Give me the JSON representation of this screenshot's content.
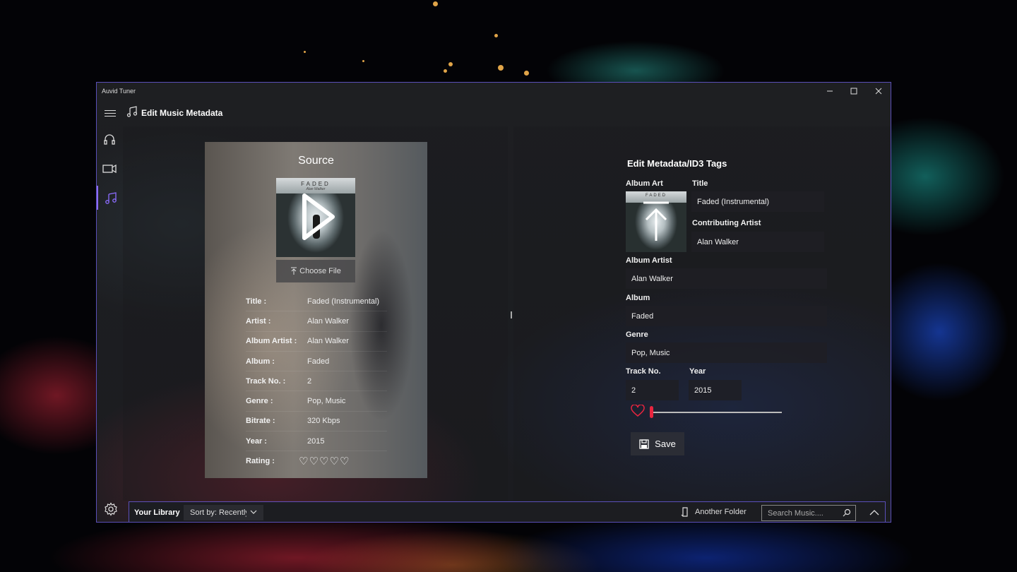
{
  "window": {
    "title": "Auvid Tuner"
  },
  "header": {
    "title": "Edit Music Metadata"
  },
  "nav": {
    "items": [
      "headphones-icon",
      "video-icon",
      "music-icon"
    ],
    "active": "music-icon"
  },
  "source": {
    "heading": "Source",
    "cover": {
      "text": "FADED",
      "artist": "Alan Walker"
    },
    "choose_file": "Choose File",
    "rows": [
      {
        "label": "Title :",
        "value": "Faded (Instrumental)"
      },
      {
        "label": "Artist :",
        "value": "Alan Walker"
      },
      {
        "label": "Album Artist :",
        "value": "Alan Walker"
      },
      {
        "label": "Album :",
        "value": "Faded"
      },
      {
        "label": "Track No. :",
        "value": "2"
      },
      {
        "label": "Genre :",
        "value": "Pop, Music"
      },
      {
        "label": "Bitrate :",
        "value": "320 Kbps"
      },
      {
        "label": "Year :",
        "value": "2015"
      }
    ],
    "rating_label": "Rating :",
    "rating": 0
  },
  "edit": {
    "heading": "Edit Metadata/ID3 Tags",
    "album_art_label": "Album Art",
    "title_label": "Title",
    "title_value": "Faded (Instrumental)",
    "contrib_label": "Contributing Artist",
    "contrib_value": "Alan Walker",
    "album_artist_label": "Album Artist",
    "album_artist_value": "Alan Walker",
    "album_label": "Album",
    "album_value": "Faded",
    "genre_label": "Genre",
    "genre_value": "Pop, Music",
    "track_label": "Track No.",
    "track_value": "2",
    "year_label": "Year",
    "year_value": "2015",
    "rating_slider": 0,
    "save_label": "Save"
  },
  "bottombar": {
    "library_label": "Your Library",
    "sort_label": "Sort by: Recently",
    "another_folder": "Another Folder",
    "search_placeholder": "Search Music...."
  },
  "colors": {
    "accent": "#8c6cff",
    "heart": "#e8253f",
    "border": "#5a4fb8"
  }
}
